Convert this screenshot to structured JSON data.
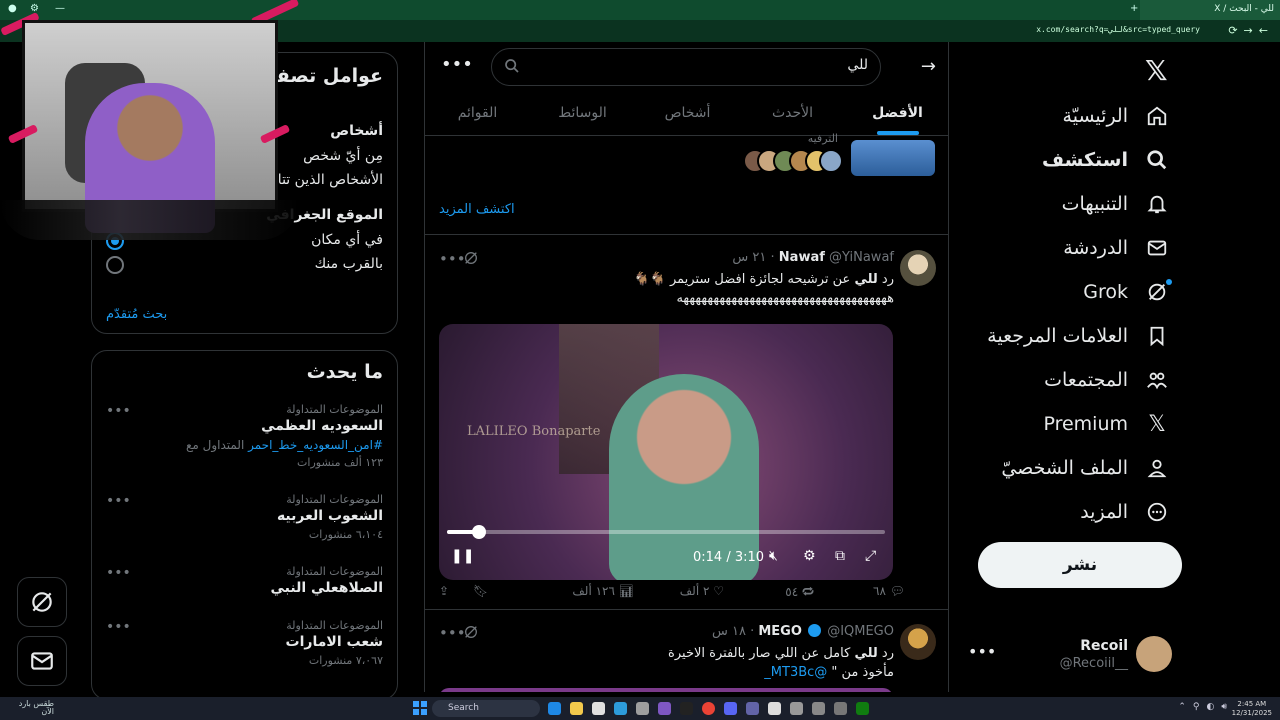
{
  "browser": {
    "tab_title": "للي - البحث / X",
    "url": "x.com/search?q=للي&src=typed_query"
  },
  "nav": {
    "items": [
      {
        "label": "الرئيسيّة",
        "icon": "home-icon"
      },
      {
        "label": "استكشف",
        "icon": "search-icon",
        "active": true
      },
      {
        "label": "التنبيهات",
        "icon": "bell-icon"
      },
      {
        "label": "الدردشة",
        "icon": "mail-icon"
      },
      {
        "label": "Grok",
        "icon": "grok-icon"
      },
      {
        "label": "العلامات المرجعية",
        "icon": "bookmark-icon"
      },
      {
        "label": "المجتمعات",
        "icon": "communities-icon"
      },
      {
        "label": "Premium",
        "icon": "x-icon"
      },
      {
        "label": "الملف الشخصيّ",
        "icon": "profile-icon"
      },
      {
        "label": "المزيد",
        "icon": "more-icon"
      }
    ],
    "post_button": "نشر",
    "account": {
      "name": "Recoil",
      "handle": "@Recoiil__"
    }
  },
  "search": {
    "query": "للي",
    "tabs": [
      "الأفضل",
      "الأحدث",
      "أشخاص",
      "الوسائط",
      "القوائم"
    ],
    "active_tab": "الأفضل"
  },
  "trend_strip": {
    "category": "الترفيه",
    "explore_more": "اكتشف المزيد"
  },
  "tweets": [
    {
      "name": "Nawaf",
      "handle": "@YiNawaf",
      "time": "٢١ س",
      "reply_prefix": "رد",
      "highlight": "للي",
      "text": "عن ترشيحه لجائزة افضل ستريمر 🐐🐐",
      "text2": "هههههههههههههههههههههههههههههههههههه",
      "video": {
        "current": "0:14",
        "duration": "3:10",
        "progress": 0.074,
        "wall_text": "LALILEO Bonaparte"
      },
      "stats": {
        "replies": "٦٨",
        "reposts": "٥٤",
        "likes": "٢ ألف",
        "views": "١٢٦ ألف"
      }
    },
    {
      "name": "MEGO",
      "handle": "@IQMEGO",
      "time": "١٨ س",
      "reply_prefix": "رد",
      "highlight": "للي",
      "text": "كامل عن اللي صار بالفترة الاخيرة",
      "text2_prefix": "مأخوذ من \"",
      "text2_link": "@MT3Bc_"
    }
  ],
  "filters": {
    "title": "عوامل تصفية البحث",
    "people_title": "أشخاص",
    "people_options": [
      "مِن أيّ شخص",
      "الأشخاص الذين تتابعهم"
    ],
    "location_title": "الموقع الجغرافي",
    "location_options": [
      "في أي مكان",
      "بالقرب منك"
    ],
    "advanced": "بحث مُتقدّم"
  },
  "whats_happening": {
    "title": "ما يحدث",
    "trends": [
      {
        "category": "الموضوعات المتداولة",
        "name": "السعوديه العظمي",
        "extra_prefix": "المتداول مع",
        "extra_link": "#امن_السعوديه_خط_احمر",
        "count": "١٢٣ ألف منشورات"
      },
      {
        "category": "الموضوعات المتداولة",
        "name": "الشعوب العربيه",
        "count": "٦،١٠٤ منشورات"
      },
      {
        "category": "الموضوعات المتداولة",
        "name": "الصلاهعلي النبي",
        "count": ""
      },
      {
        "category": "الموضوعات المتداولة",
        "name": "شعب الامارات",
        "count": "٧،٠٦٧ منشورات"
      }
    ]
  },
  "taskbar": {
    "weather": "طقس بارد الآن",
    "search": "Search",
    "time": "2:45 AM",
    "date": "12/31/2025"
  },
  "colors": {
    "accent": "#1d9bf0",
    "background": "#000000",
    "chrome": "#0f4b2e"
  }
}
